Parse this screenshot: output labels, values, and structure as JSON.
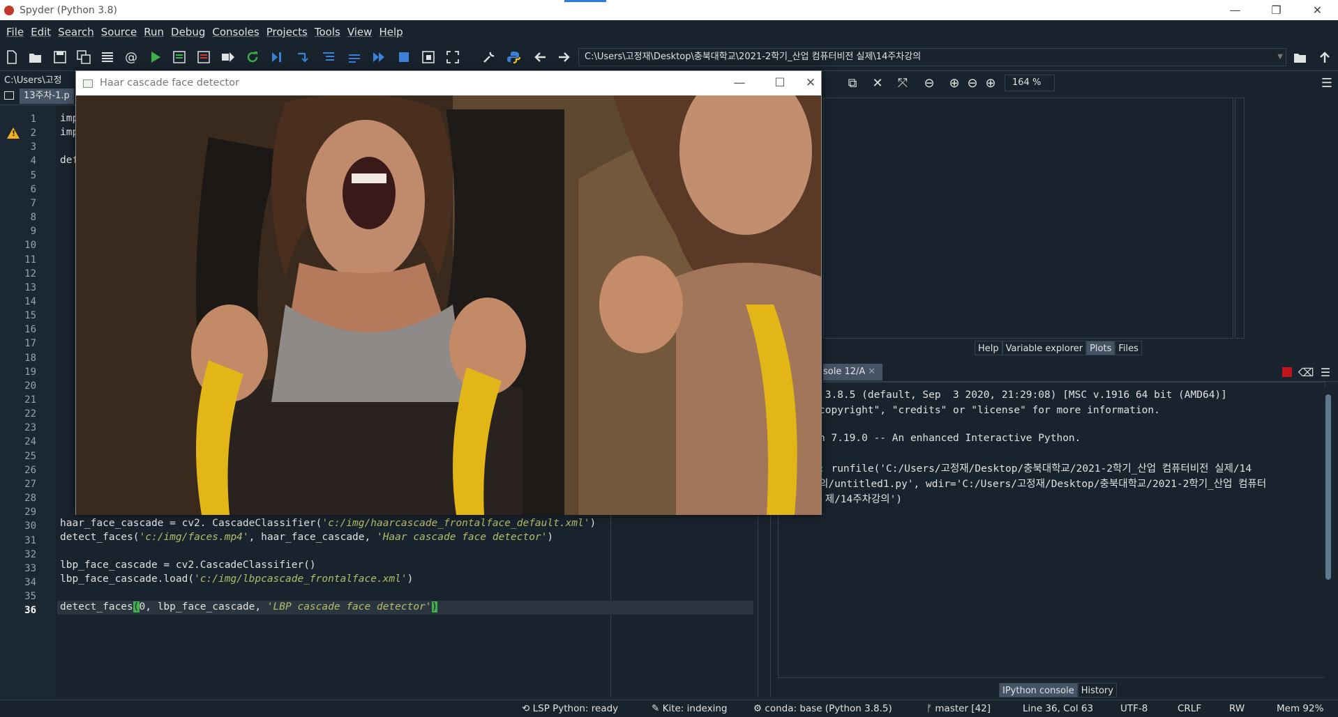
{
  "window": {
    "title": "Spyder (Python 3.8)",
    "controls": [
      "—",
      "❐",
      "✕"
    ]
  },
  "menu": [
    "File",
    "Edit",
    "Search",
    "Source",
    "Run",
    "Debug",
    "Consoles",
    "Projects",
    "Tools",
    "View",
    "Help"
  ],
  "toolbar": {
    "path": "C:\\Users\\고정재\\Desktop\\충북대학교\\2021-2학기_산업 컴퓨터비전 실제\\14주차강의"
  },
  "editor": {
    "path_label": "C:\\Users\\고정",
    "tab_label": "13주차-1.p",
    "line_numbers": [
      "1",
      "2",
      "3",
      "4",
      "5",
      "6",
      "7",
      "8",
      "9",
      "10",
      "11",
      "12",
      "13",
      "14",
      "15",
      "16",
      "17",
      "18",
      "19",
      "20",
      "21",
      "22",
      "23",
      "24",
      "25",
      "26",
      "27",
      "28",
      "29",
      "30",
      "31",
      "32",
      "33",
      "34",
      "35",
      "36"
    ],
    "current_line": "36",
    "top_fragments": [
      "imp",
      "imp",
      "",
      "def"
    ],
    "code": {
      "l30_a": "haar_face_cascade = cv2. CascadeClassifier(",
      "l30_s": "'c:/img/haarcascade_frontalface_default.xml'",
      "l30_b": ")",
      "l31_a": "detect_faces(",
      "l31_s1": "'c:/img/faces.mp4'",
      "l31_b": ", haar_face_cascade, ",
      "l31_s2": "'Haar cascade face detector'",
      "l31_c": ")",
      "l33": "lbp_face_cascade = cv2.CascadeClassifier()",
      "l34_a": "lbp_face_cascade.load(",
      "l34_s": "'c:/img/lbpcascade_frontalface.xml'",
      "l34_b": ")",
      "l36_a": "detect_faces",
      "l36_p1": "(",
      "l36_b": "0, lbp_face_cascade, ",
      "l36_s": "'LBP cascade face detector'",
      "l36_p2": ")"
    }
  },
  "plots": {
    "zoom": "164 %",
    "tabs": [
      "Help",
      "Variable explorer",
      "Plots",
      "Files"
    ],
    "active_tab": "Plots"
  },
  "console": {
    "tab_label": "sole 12/A",
    "lines": [
      " 3.8.5 (default, Sep  3 2020, 21:29:08) [MSC v.1916 64 bit (AMD64)]",
      "copyright\", \"credits\" or \"license\" for more information.",
      "n 7.19.0 -- An enhanced Interactive Python.",
      " runfile('C:/Users/고정재/Desktop/충북대학교/2021-2학기_산업 컴퓨터비전 실제/14",
      "의/untitled1.py', wdir='C:/Users/고정재/Desktop/충북대학교/2021-2학기_산업 컴퓨터",
      " 제/14주차강의')"
    ],
    "prompt_mark": ":",
    "tabs": [
      "IPython console",
      "History"
    ],
    "active_tab": "IPython console"
  },
  "statusbar": {
    "lsp": "LSP Python: ready",
    "kite": "Kite: indexing",
    "conda": "conda: base (Python 3.8.5)",
    "git": "master [42]",
    "position": "Line 36, Col 63",
    "encoding": "UTF-8",
    "eol": "CRLF",
    "perm": "RW",
    "mem": "Mem 92%"
  },
  "cv_window": {
    "title": "Haar cascade face detector",
    "controls": [
      "—",
      "☐",
      "✕"
    ]
  }
}
